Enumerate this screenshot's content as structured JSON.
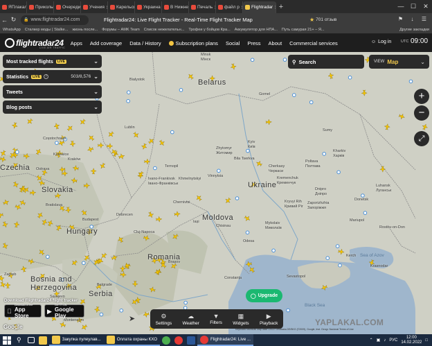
{
  "browser": {
    "tabs": [
      {
        "label": "ЯПлакал",
        "color": "#e84b3c"
      },
      {
        "label": "Приколы",
        "color": "#e84b3c"
      },
      {
        "label": "Очереди",
        "color": "#e84b3c"
      },
      {
        "label": "Учения",
        "color": "#e84b3c"
      },
      {
        "label": "Карельский",
        "color": "#e84b3c"
      },
      {
        "label": "Украина",
        "color": "#e84b3c"
      },
      {
        "label": "В Нижнем",
        "color": "#e84b3c"
      },
      {
        "label": "Печаль",
        "color": "#e84b3c"
      },
      {
        "label": "файл р",
        "color": "#e84b3c"
      },
      {
        "label": "Flightradar",
        "color": "#f2c94c",
        "active": true
      }
    ],
    "url": "www.flightradar24.com",
    "page_title": "Flightradar24: Live Flight Tracker - Real-Time Flight Tracker Map",
    "reviews": "701 отзыв",
    "bookmarks": [
      "WhatsApp",
      "Сталкер моды ( Stalke...",
      "жизнь после...",
      "Форумы – AMK Team",
      "Список нежелательн...",
      "Трофеи у бойцов Кра...",
      "Аккумулятор для НПА...",
      "Путь самурая 21+ – Я..."
    ],
    "other_bookmarks": "Другие закладки"
  },
  "site": {
    "logo": "flightradar24",
    "logo_sub": "LIVE AIR TRAFFIC",
    "nav": [
      "Apps",
      "Add coverage",
      "Data / History",
      "Subscription plans",
      "Social",
      "Press",
      "About",
      "Commercial services"
    ],
    "login": "Log in",
    "utc_label": "UTC",
    "clock": "09:00"
  },
  "panels": {
    "most_tracked": "Most tracked flights",
    "statistics": "Statistics",
    "stats_count": "503/8,576",
    "tweets": "Tweets",
    "blog_posts": "Blog posts",
    "live": "LIVE"
  },
  "search_label": "Search",
  "view": {
    "label": "VIEW",
    "value": "Map"
  },
  "upgrade_label": "Upgrade",
  "promo": {
    "title": "Download Flightradar24 flight tracker",
    "appstore_small": "Download on the",
    "appstore_big": "App Store",
    "googleplay_small": "GET IT ON",
    "googleplay_big": "Google Play"
  },
  "google_mark": "Google",
  "toolbar": [
    "Settings",
    "Weather",
    "Filters",
    "Widgets",
    "Playback"
  ],
  "attribution": "Keyboard shortcuts   Map data ©2022 GeoBasis-DE/BKG (©2009), Google, Inst. Geogr. Nacional   Terms of Use",
  "watermark": "YAPLAKAL.COM",
  "map_labels": {
    "countries": [
      "Belarus",
      "Ukraine",
      "Moldova",
      "Romania",
      "Slovakia",
      "Hungary",
      "Czechia",
      "Serbia",
      "Bosnia and Herzegovina"
    ],
    "cities": [
      "Minsk",
      "Мінск",
      "Bialystok",
      "Lublin",
      "Kyiv",
      "Київ",
      "Zhytomyr",
      "Житомир",
      "Bila Tserkva",
      "Cherkasy",
      "Черкаси",
      "Poltava",
      "Полтава",
      "Kharkiv",
      "Харків",
      "Dnipro",
      "Дніпро",
      "Kryvyi Rih",
      "Кривий Ріг",
      "Zaporizhzhia",
      "Запоріжжя",
      "Mykolaiv",
      "Миколаїв",
      "Donetsk",
      "Luhansk",
      "Луганськ",
      "Mariupol",
      "Odesa",
      "Chisinau",
      "Кременчук",
      "Kremenchuk",
      "Vinnytsia",
      "Khmelnytskyi",
      "Chernivtsi",
      "Ivano-Frankivsk",
      "Івано-Франківськ",
      "Ternopil",
      "Kraków",
      "Katowice",
      "Częstochowa",
      "Ostrava",
      "Bratislava",
      "Budapest",
      "Debrecen",
      "Cluj-Napoca",
      "Iași",
      "Brașov",
      "Constanța",
      "Sevastopol",
      "Kerch",
      "Krasnodar",
      "Rostov-on-Don",
      "Zagreb",
      "Belgrade",
      "Sumy",
      "Montenegro",
      "Sarajevo",
      "Gomel",
      "Krasnodar"
    ],
    "sea": [
      "Black Sea",
      "Sea of Azov"
    ]
  },
  "taskbar": {
    "apps": [
      "Закупка пулеулав...",
      "Оплата охраны КХО",
      "Flightradar24: Live ..."
    ],
    "lang": "РУС",
    "time": "12:00",
    "date": "14.02.2022"
  }
}
